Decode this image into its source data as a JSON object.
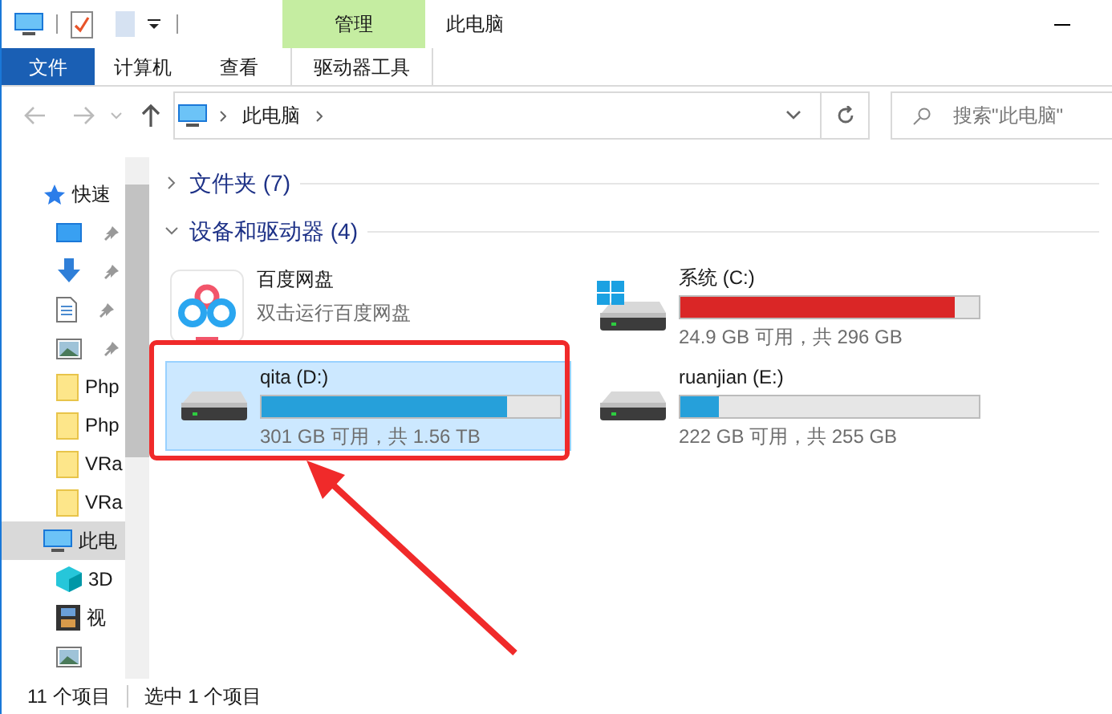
{
  "window": {
    "title": "此电脑",
    "context_tab": "管理"
  },
  "ribbon_tabs": [
    {
      "label": "文件",
      "kind": "file"
    },
    {
      "label": "计算机",
      "kind": "tab"
    },
    {
      "label": "查看",
      "kind": "tab"
    },
    {
      "label": "驱动器工具",
      "kind": "context"
    }
  ],
  "address": {
    "path": "此电脑"
  },
  "search": {
    "placeholder": "搜索\"此电脑\""
  },
  "sidebar": {
    "items": [
      {
        "label": "快速",
        "kind": "star",
        "selected": false
      },
      {
        "kind": "desktop",
        "pinned": true,
        "selected": false
      },
      {
        "kind": "download",
        "pinned": true,
        "selected": false
      },
      {
        "kind": "document",
        "pinned": true,
        "selected": false
      },
      {
        "kind": "image",
        "pinned": true,
        "selected": false
      },
      {
        "label": "Php",
        "kind": "folder",
        "selected": false
      },
      {
        "label": "Php",
        "kind": "folder",
        "selected": false
      },
      {
        "label": "VRa",
        "kind": "folder",
        "selected": false
      },
      {
        "label": "VRa",
        "kind": "folder",
        "selected": false
      },
      {
        "label": "此电",
        "kind": "pc",
        "selected": true
      },
      {
        "label": "3D",
        "kind": "cube",
        "selected": false
      },
      {
        "label": "视",
        "kind": "video",
        "selected": false
      },
      {
        "kind": "image",
        "selected": false
      }
    ]
  },
  "sections": [
    {
      "title": "文件夹 (7)",
      "expanded": false
    },
    {
      "title": "设备和驱动器 (4)",
      "expanded": true
    }
  ],
  "devices": [
    {
      "kind": "app",
      "name": "百度网盘",
      "subtitle": "双击运行百度网盘",
      "selected": false
    },
    {
      "kind": "drive",
      "name": "系统 (C:)",
      "system": true,
      "level": 0.92,
      "low_space": true,
      "free": "24.9 GB 可用，共 296 GB",
      "selected": false
    },
    {
      "kind": "drive",
      "name": "qita (D:)",
      "system": false,
      "level": 0.82,
      "low_space": false,
      "free": "301 GB 可用，共 1.56 TB",
      "selected": true
    },
    {
      "kind": "drive",
      "name": "ruanjian (E:)",
      "system": false,
      "level": 0.13,
      "low_space": false,
      "free": "222 GB 可用，共 255 GB",
      "selected": false
    }
  ],
  "status_bar": {
    "count": "11 个项目",
    "selection": "选中 1 个项目"
  }
}
